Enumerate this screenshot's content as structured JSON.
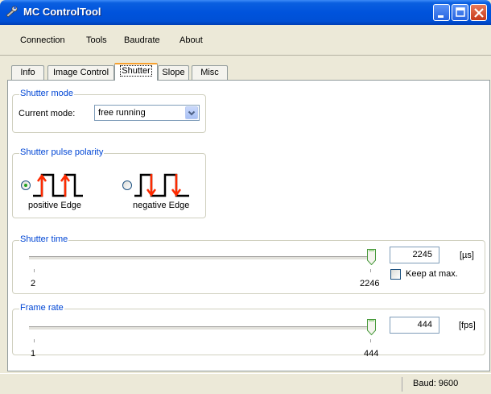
{
  "window": {
    "title": "MC ControlTool"
  },
  "menu": {
    "items": [
      "Connection",
      "Tools",
      "Baudrate",
      "About"
    ]
  },
  "tabs": [
    "Info",
    "Image Control",
    "Shutter",
    "Slope",
    "Misc"
  ],
  "active_tab": "Shutter",
  "shutter_mode": {
    "group_title": "Shutter mode",
    "label": "Current mode:",
    "value": "free running"
  },
  "pulse_polarity": {
    "group_title": "Shutter pulse polarity",
    "positive_label": "positive Edge",
    "negative_label": "negative Edge",
    "selected": "positive Edge"
  },
  "shutter_time": {
    "group_title": "Shutter time",
    "min_label": "2",
    "max_label": "2246",
    "value": "2245",
    "unit": "[µs]",
    "keep_at_max_label": "Keep at max.",
    "keep_at_max_checked": false
  },
  "frame_rate": {
    "group_title": "Frame rate",
    "min_label": "1",
    "max_label": "444",
    "value": "444",
    "unit": "[fps]"
  },
  "status": {
    "baud": "Baud: 9600"
  },
  "colors": {
    "titlebar": "#0053dc",
    "group_title": "#0046d5",
    "active_tab_accent": "#f7a12f",
    "edge_arrow": "#ff2a00",
    "radio_dot": "#21a121",
    "slider_thumb": "#4caf50"
  },
  "icons": [
    "app-wrench-icon",
    "minimize-icon",
    "maximize-icon",
    "close-icon",
    "dropdown-chevron-icon",
    "positive-edge-icon",
    "negative-edge-icon",
    "slider-thumb-icon"
  ]
}
